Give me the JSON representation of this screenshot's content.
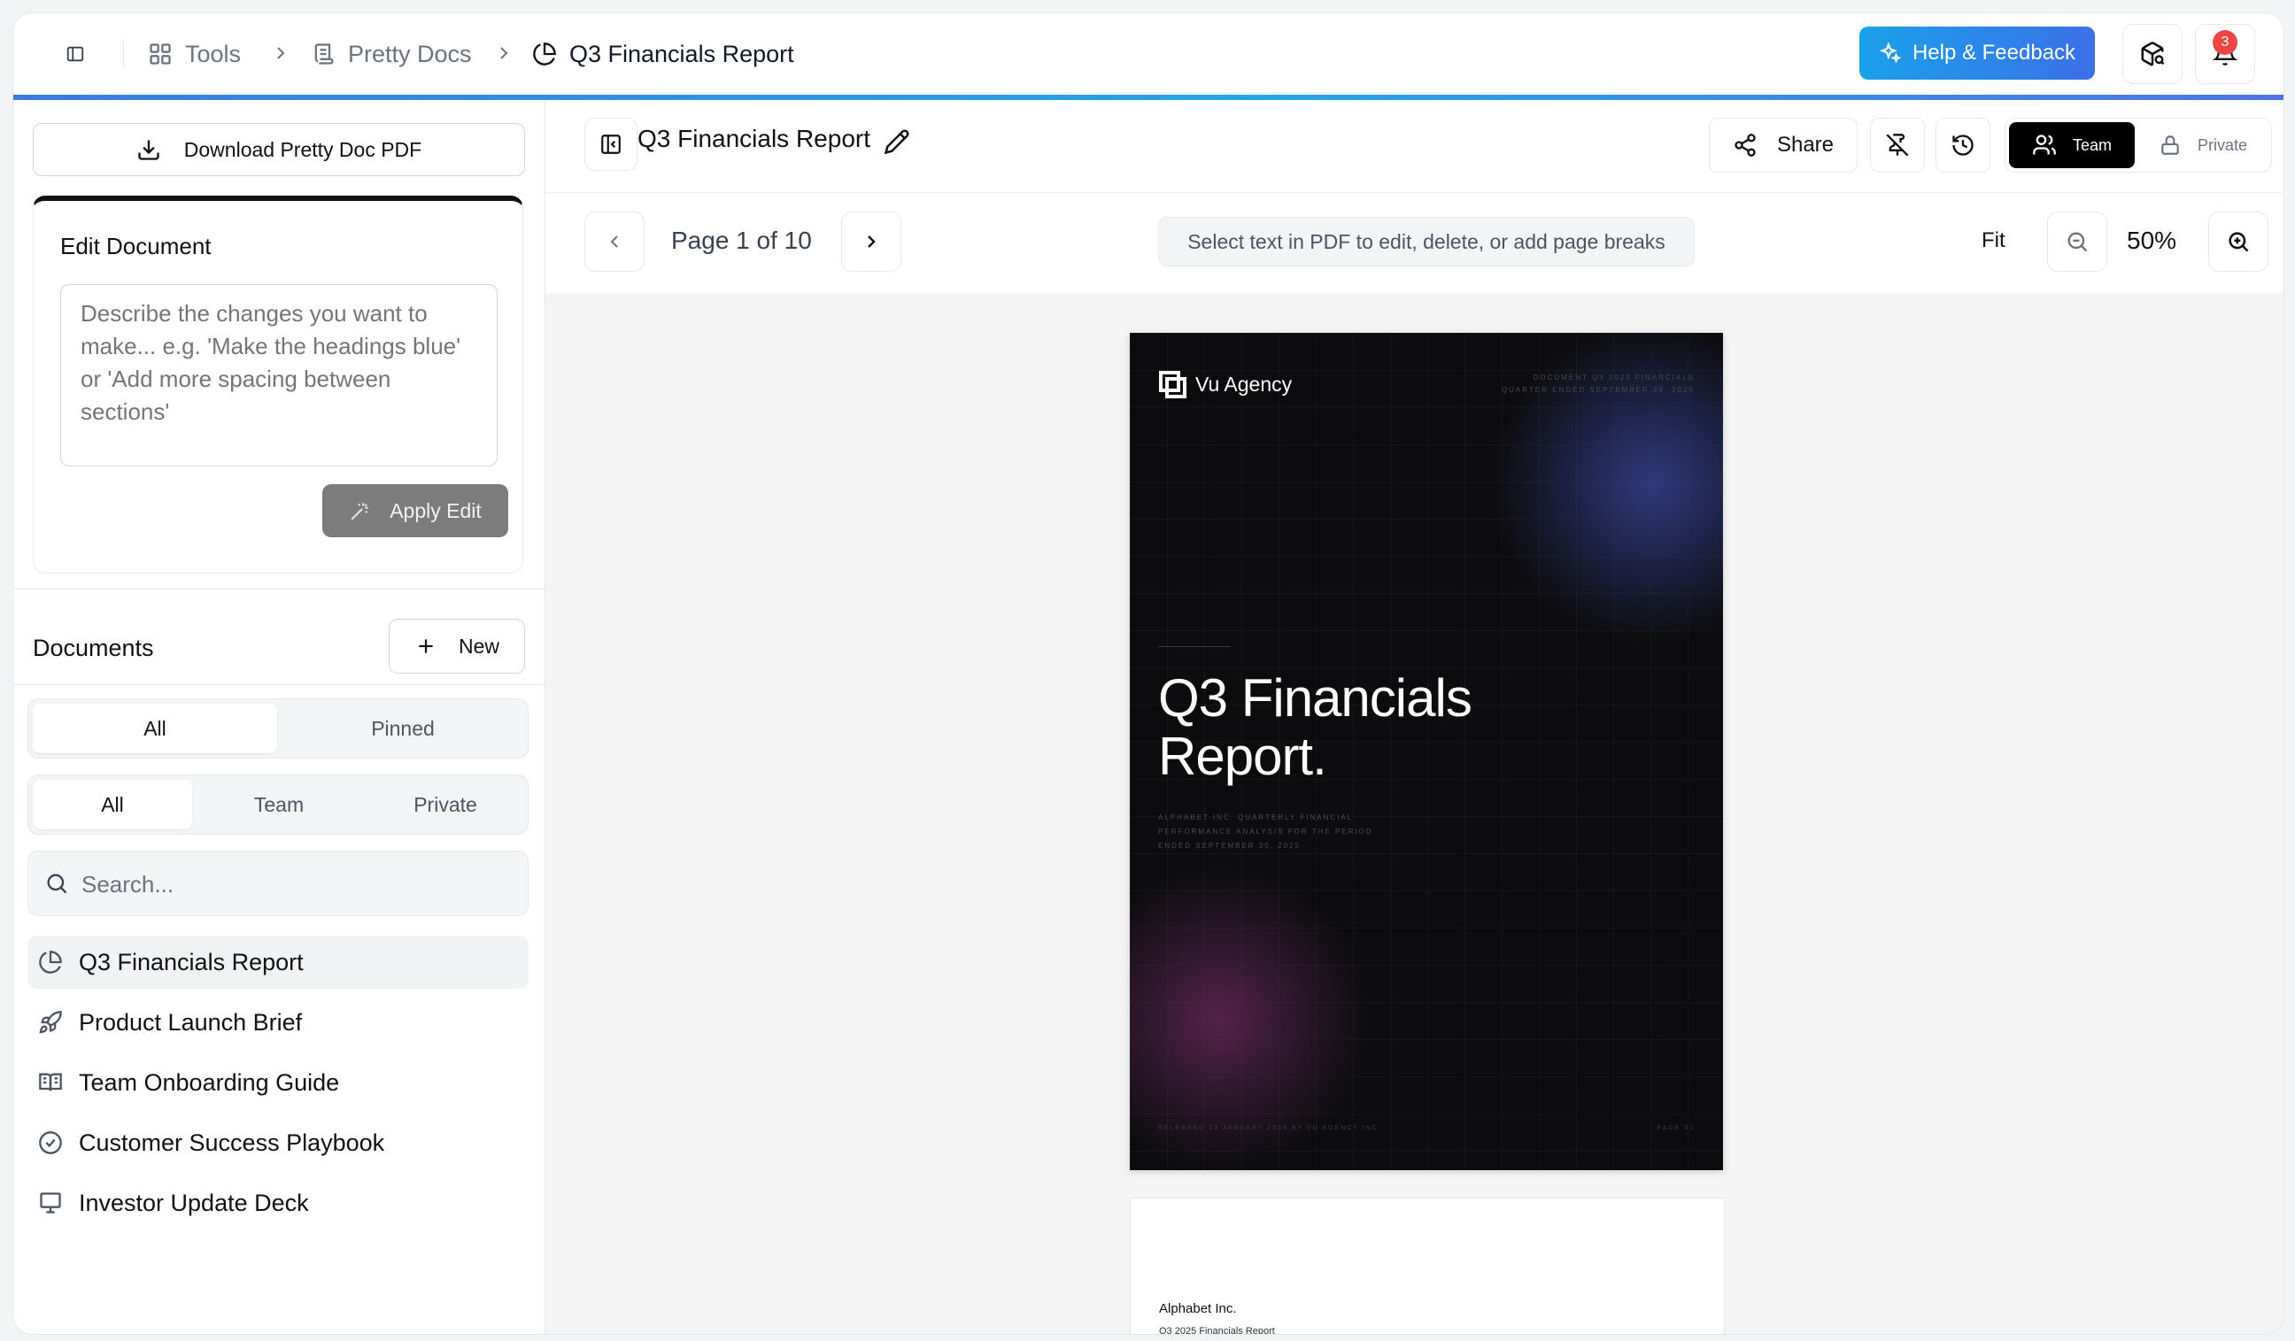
{
  "breadcrumbs": [
    {
      "label": "Tools",
      "icon": "grid-icon"
    },
    {
      "label": "Pretty Docs",
      "icon": "scroll-icon"
    },
    {
      "label": "Q3 Financials Report",
      "icon": "pie-chart-icon"
    }
  ],
  "header": {
    "help_label": "Help & Feedback",
    "notification_count": "3",
    "accent_colors": [
      "#1aa1ea",
      "#3b6fe8"
    ]
  },
  "sidebar": {
    "download_label": "Download Pretty Doc PDF",
    "edit": {
      "title": "Edit Document",
      "placeholder": "Describe the changes you want to make... e.g. 'Make the headings blue' or 'Add more spacing between sections'",
      "value": "",
      "apply_label": "Apply Edit"
    },
    "documents_title": "Documents",
    "new_label": "New",
    "filter_pinned": {
      "options": [
        "All",
        "Pinned"
      ],
      "selected": "All"
    },
    "filter_scope": {
      "options": [
        "All",
        "Team",
        "Private"
      ],
      "selected": "All"
    },
    "search_placeholder": "Search...",
    "items": [
      {
        "label": "Q3 Financials Report",
        "icon": "pie-chart-icon",
        "active": true
      },
      {
        "label": "Product Launch Brief",
        "icon": "rocket-icon",
        "active": false
      },
      {
        "label": "Team Onboarding Guide",
        "icon": "book-open-icon",
        "active": false
      },
      {
        "label": "Customer Success Playbook",
        "icon": "check-circle-icon",
        "active": false
      },
      {
        "label": "Investor Update Deck",
        "icon": "presentation-icon",
        "active": false
      }
    ]
  },
  "document": {
    "title": "Q3 Financials Report",
    "share_label": "Share",
    "visibility": {
      "options": [
        "Team",
        "Private"
      ],
      "selected": "Team"
    }
  },
  "viewer": {
    "page_indicator": "Page 1 of 10",
    "hint": "Select text in PDF to edit, delete, or add page breaks",
    "fit_label": "Fit",
    "zoom": "50%"
  },
  "pdf": {
    "cover": {
      "brand": "Vu Agency",
      "meta_lines": [
        "DOCUMENT Q3 2025 FINANCIALS",
        "QUARTER ENDED SEPTEMBER 30, 2025"
      ],
      "title_lines": [
        "Q3 Financials",
        "Report."
      ],
      "subtitle": "ALPHABET INC. QUARTERLY FINANCIAL PERFORMANCE ANALYSIS FOR THE PERIOD ENDED SEPTEMBER 30, 2025",
      "footer_left": "RELEASED 29 JANUARY 2026 BY VU AGENCY INC.",
      "footer_right": "PAGE 01"
    },
    "page2": {
      "company": "Alphabet Inc.",
      "subtitle": "Q3 2025 Financials Report"
    }
  }
}
